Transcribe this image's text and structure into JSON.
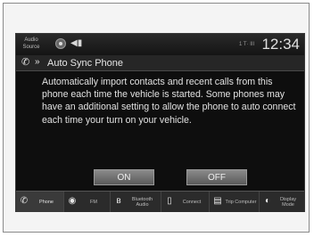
{
  "status_bar": {
    "source_label": "Audio Source",
    "radio_icon": "radio-icon",
    "volume_icon": "speaker-icon",
    "signal_text": "1 T· III",
    "clock": "12:34"
  },
  "title_bar": {
    "phone_icon": "phone-icon",
    "chevron": "»",
    "title": "Auto Sync Phone"
  },
  "message": "Automatically import contacts and recent calls from this phone each time the vehicle is started. Some phones may have an additional setting to allow the phone to auto connect each time your turn on your vehicle.",
  "buttons": {
    "on_label": "ON",
    "off_label": "OFF"
  },
  "nav": [
    {
      "icon": "phone-icon",
      "label": "Phone"
    },
    {
      "icon": "radio-icon",
      "label": "FM"
    },
    {
      "icon": "bluetooth-icon",
      "label": "Bluetooth Audio"
    },
    {
      "icon": "connect-icon",
      "label": "Connect"
    },
    {
      "icon": "trip-computer-icon",
      "label": "Trip Computer"
    },
    {
      "icon": "display-mode-icon",
      "label": "Display Mode"
    }
  ]
}
